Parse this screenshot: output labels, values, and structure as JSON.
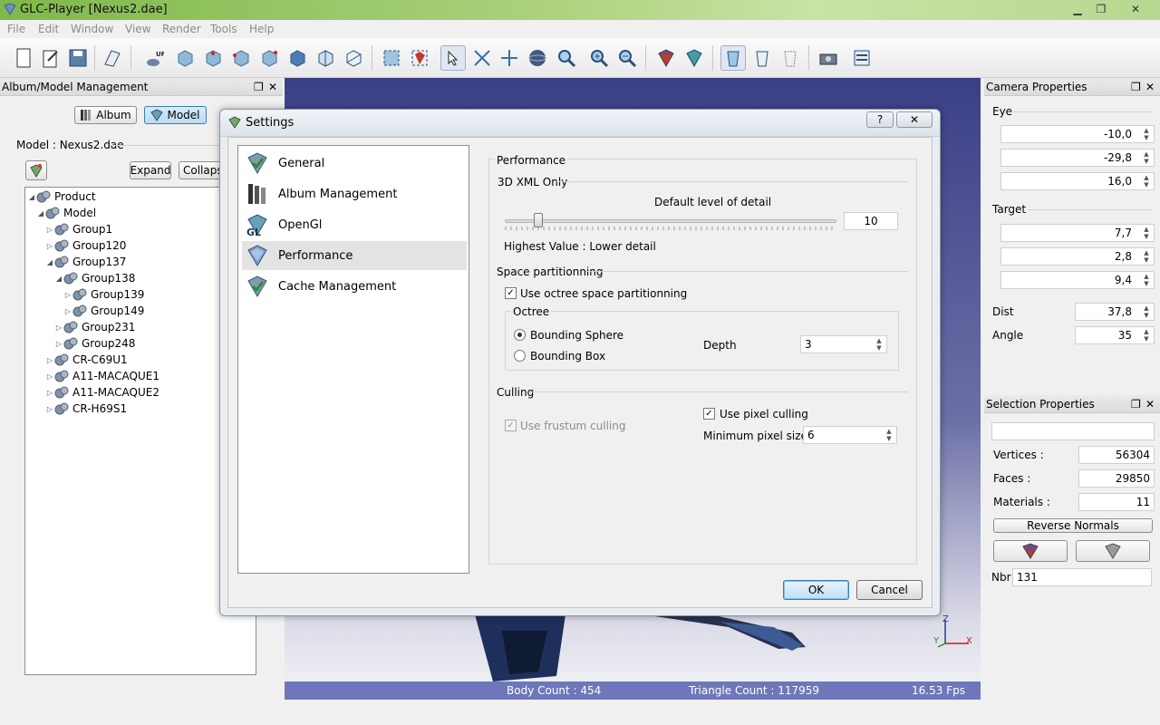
{
  "window": {
    "title": "GLC-Player [Nexus2.dae]"
  },
  "menu": [
    "File",
    "Edit",
    "Window",
    "View",
    "Render",
    "Tools",
    "Help"
  ],
  "toolbar_icons": [
    "new-file-icon",
    "open-file-icon",
    "save-file-icon",
    "open-album-icon",
    "up-view-icon",
    "iso-view-icon",
    "front-view-icon",
    "right-view-icon",
    "back-view-icon",
    "left-view-icon",
    "top-view-icon",
    "bottom-view-icon",
    "zoom-all-icon",
    "zoom-selection-icon",
    "select-cursor-icon",
    "pan-fit-icon",
    "pan-icon",
    "orbit-icon",
    "zoom-region-icon",
    "zoom-in-icon",
    "zoom-out-icon",
    "material-shading-icon",
    "wire-shading-icon",
    "render-bodies-icon",
    "render-clear-icon",
    "render-transparent-icon",
    "snapshot-icon",
    "settings-panel-icon"
  ],
  "album_panel": {
    "title": "Album/Model Management",
    "album_button": "Album",
    "model_button": "Model",
    "model_label": "Model : Nexus2.dae",
    "expand": "Expand",
    "collapse": "Collapse",
    "tree": [
      {
        "label": "Product",
        "level": 0,
        "expanded": true
      },
      {
        "label": "Model",
        "level": 1,
        "expanded": true
      },
      {
        "label": "Group1",
        "level": 2,
        "expanded": false
      },
      {
        "label": "Group120",
        "level": 2,
        "expanded": false
      },
      {
        "label": "Group137",
        "level": 2,
        "expanded": true
      },
      {
        "label": "Group138",
        "level": 3,
        "expanded": true
      },
      {
        "label": "Group139",
        "level": 4,
        "expanded": false
      },
      {
        "label": "Group149",
        "level": 4,
        "expanded": false
      },
      {
        "label": "Group231",
        "level": 3,
        "expanded": false
      },
      {
        "label": "Group248",
        "level": 3,
        "expanded": false
      },
      {
        "label": "CR-C69U1",
        "level": 2,
        "expanded": false
      },
      {
        "label": "A11-MACAQUE1",
        "level": 2,
        "expanded": false
      },
      {
        "label": "A11-MACAQUE2",
        "level": 2,
        "expanded": false
      },
      {
        "label": "CR-H69S1",
        "level": 2,
        "expanded": false
      }
    ]
  },
  "camera_panel": {
    "title": "Camera Properties",
    "eye_label": "Eye",
    "eye": [
      "-10,0",
      "-29,8",
      "16,0"
    ],
    "target_label": "Target",
    "target": [
      "7,7",
      "2,8",
      "9,4"
    ],
    "dist_label": "Dist",
    "dist": "37,8",
    "angle_label": "Angle",
    "angle": "35"
  },
  "selection_panel": {
    "title": "Selection Properties",
    "name_value": "",
    "vertices_label": "Vertices :",
    "vertices": "56304",
    "faces_label": "Faces :",
    "faces": "29850",
    "materials_label": "Materials :",
    "materials": "11",
    "reverse_normals": "Reverse Normals",
    "nbr_label": "Nbr",
    "nbr": "131"
  },
  "status": {
    "body_count": "Body Count : 454",
    "triangle_count": "Triangle Count : 117959",
    "fps": "16.53 Fps"
  },
  "axes": {
    "z": "Z",
    "y": "Y",
    "x": "X"
  },
  "dialog": {
    "title": "Settings",
    "help": "?",
    "close": "✕",
    "nav": [
      "General",
      "Album Management",
      "OpenGl",
      "Performance",
      "Cache Management"
    ],
    "selected_nav": "Performance",
    "performance": {
      "heading": "Performance",
      "xml_section": "3D XML Only",
      "lod_label": "Default level of detail",
      "lod_value": "10",
      "lod_slider": 0.1,
      "lod_hint": "Highest Value : Lower detail",
      "space_section": "Space partitionning",
      "use_octree": "Use octree space partitionning",
      "octree_group": "Octree",
      "bounding_sphere": "Bounding Sphere",
      "bounding_box": "Bounding Box",
      "depth_label": "Depth",
      "depth_value": "3",
      "culling_section": "Culling",
      "use_frustum": "Use frustum culling",
      "use_pixel": "Use pixel culling",
      "min_pixel_label": "Minimum pixel size",
      "min_pixel_value": "6"
    },
    "ok": "OK",
    "cancel": "Cancel"
  },
  "colors": {
    "titlebar_green": "#8cc35a",
    "viewport_blue": "#3b3f86",
    "status_blue": "#6e77b9",
    "selection_accent": "#3c7fb1"
  }
}
